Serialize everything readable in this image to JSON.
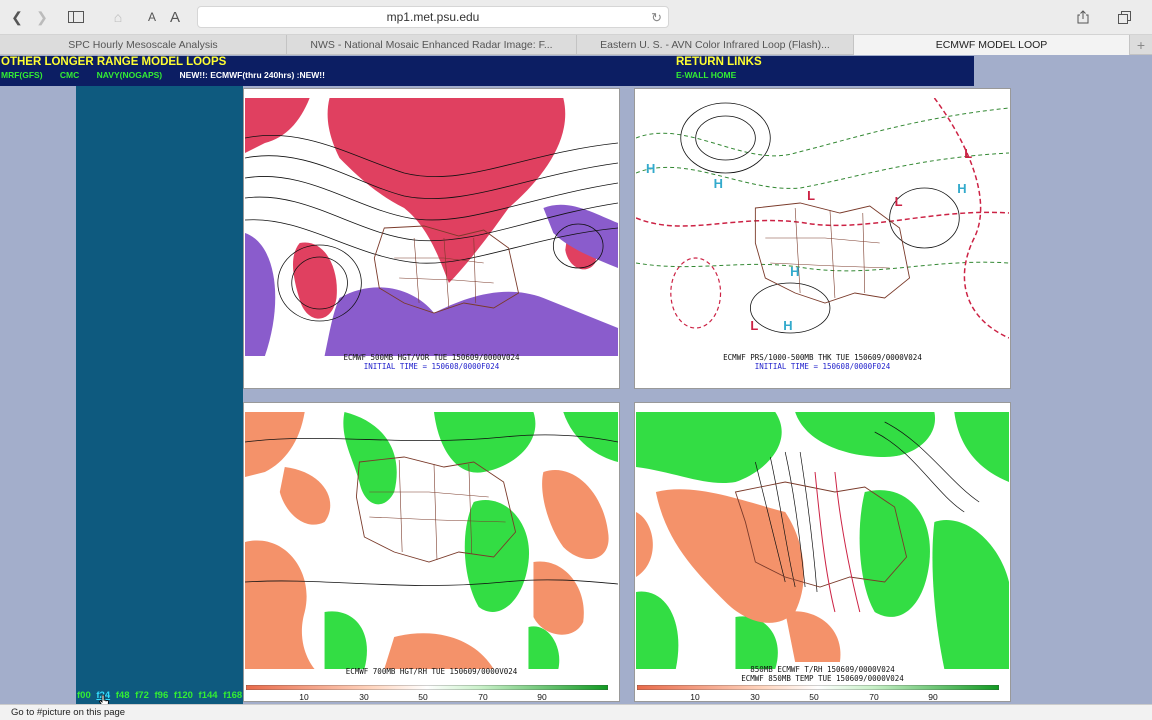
{
  "browser": {
    "url": "mp1.met.psu.edu",
    "font_small": "A",
    "font_large": "A",
    "tabs": [
      {
        "label": "SPC Hourly Mesoscale Analysis",
        "active": false
      },
      {
        "label": "NWS - National Mosaic Enhanced Radar Image: F...",
        "active": false
      },
      {
        "label": "Eastern U. S. - AVN Color Infrared Loop (Flash)...",
        "active": false
      },
      {
        "label": "ECMWF MODEL LOOP",
        "active": true
      }
    ],
    "status_text": "Go to #picture on this page"
  },
  "nav": {
    "title": "OTHER LONGER RANGE MODEL LOOPS",
    "links": [
      "MRF(GFS)",
      "CMC",
      "NAVY(NOGAPS)"
    ],
    "new_text": "NEW!!: ECMWF(thru 240hrs) :NEW!!",
    "return_title": "RETURN LINKS",
    "ewall": "E-WALL HOME"
  },
  "frames": {
    "items": [
      "f00",
      "f24",
      "f48",
      "f72",
      "f96",
      "f120",
      "f144",
      "f168"
    ],
    "current": "f24"
  },
  "panels": {
    "p1": {
      "caption": "ECMWF 500MB HGT/VOR TUE 150609/0000V024",
      "init": "INITIAL TIME = 150608/0000F024"
    },
    "p2": {
      "caption": "ECMWF PRS/1000-500MB THK TUE 150609/0000V024",
      "init": "INITIAL TIME = 150608/0000F024"
    },
    "p3": {
      "caption": "ECMWF 700MB HGT/RH TUE 150609/0000V024",
      "ticks": [
        "10",
        "30",
        "50",
        "70",
        "90"
      ]
    },
    "p4": {
      "caption1": "850MB ECMWF T/RH 150609/0000V024",
      "caption2": "ECMWF 850MB TEMP TUE 150609/0000V024",
      "ticks": [
        "10",
        "30",
        "50",
        "70",
        "90"
      ]
    }
  },
  "colors": {
    "nav_bg": "#0c1e63",
    "sidebar_bg": "#0e5a7f",
    "title_yellow": "#ffff33",
    "link_green": "#33ee33",
    "page_bg": "#a3aecb",
    "vort_red": "#e04060",
    "vort_purple": "#8a5ccc",
    "rh_green": "#33dd44",
    "dry_orange": "#f4926a"
  }
}
